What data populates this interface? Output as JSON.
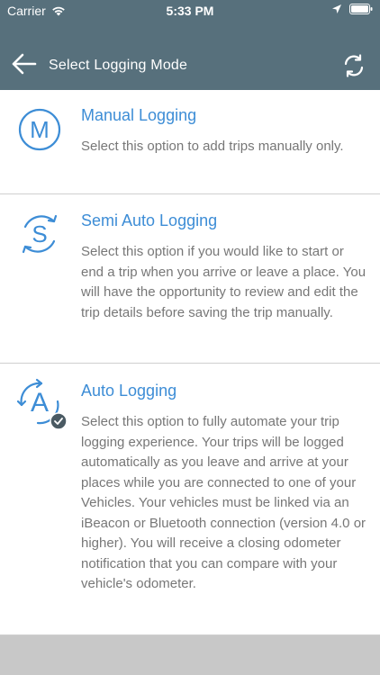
{
  "status": {
    "carrier": "Carrier",
    "time": "5:33 PM"
  },
  "nav": {
    "title": "Select Logging Mode"
  },
  "options": [
    {
      "letter": "M",
      "title": "Manual Logging",
      "description": "Select this option to add trips manually only.",
      "selected": false
    },
    {
      "letter": "S",
      "title": "Semi Auto Logging",
      "description": "Select this option if you would like to start or end a trip when you arrive or leave a place.  You will have the opportunity to review and edit the trip details before saving the trip manually.",
      "selected": false
    },
    {
      "letter": "A",
      "title": "Auto Logging",
      "description": "Select this option to fully automate your trip logging experience.  Your trips will be logged automatically as you leave and arrive at your places while you are connected to one of your Vehicles.  Your vehicles must be linked via an iBeacon or Bluetooth connection (version 4.0 or higher).  You will receive a closing odometer notification that you can compare with your vehicle's odometer.",
      "selected": true
    }
  ],
  "colors": {
    "header": "#57707c",
    "accent": "#3d8dd6",
    "text": "#777777",
    "check_badge": "#4a5a63"
  }
}
